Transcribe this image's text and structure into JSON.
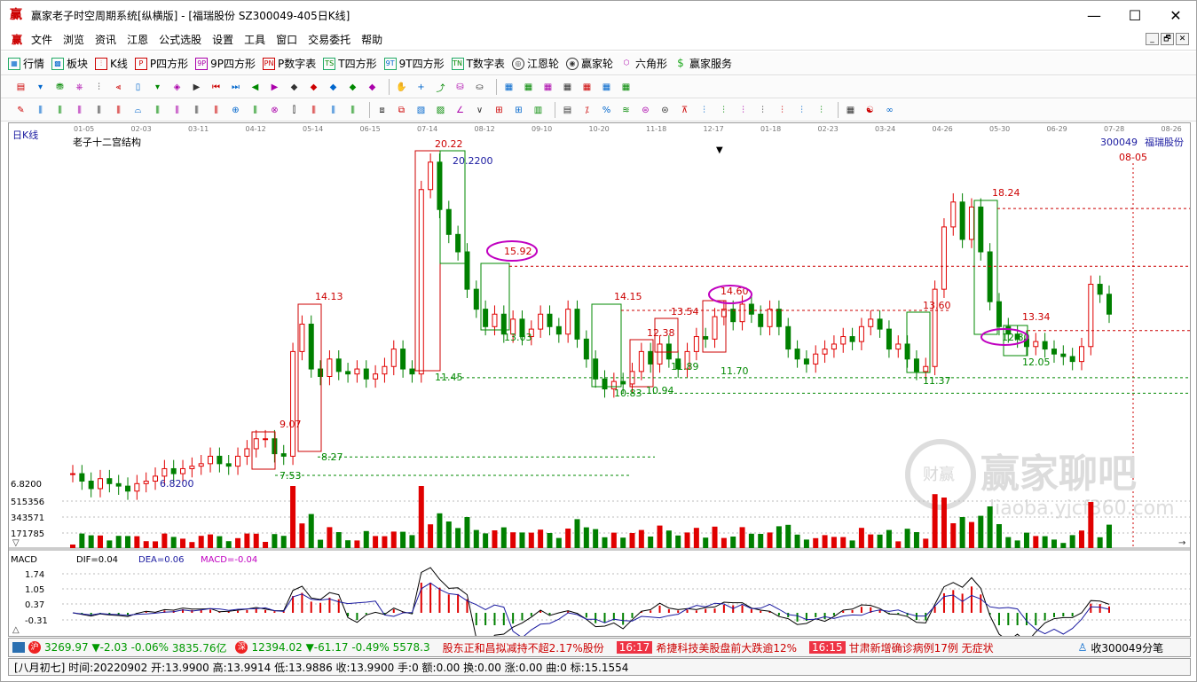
{
  "window": {
    "title": "赢家老子时空周期系统[纵横版] - [福瑞股份  SZ300049-405日K线]",
    "minimize": "—",
    "maximize": "☐",
    "close": "✕"
  },
  "menu": {
    "app_icon": "赢",
    "items": [
      "文件",
      "浏览",
      "资讯",
      "江恩",
      "公式选股",
      "设置",
      "工具",
      "窗口",
      "交易委托",
      "帮助"
    ]
  },
  "mdi": [
    "_",
    "🗗",
    "✕"
  ],
  "toolbar1": [
    {
      "label": "行情",
      "icon": "grid-icon"
    },
    {
      "label": "板块",
      "icon": "blocks-icon"
    },
    {
      "label": "K线",
      "icon": "candles-icon"
    },
    {
      "label": "P四方形",
      "icon": "P"
    },
    {
      "label": "9P四方形",
      "icon": "9P"
    },
    {
      "label": "P数字表",
      "icon": "PN"
    },
    {
      "label": "T四方形",
      "icon": "TS"
    },
    {
      "label": "9T四方形",
      "icon": "9T"
    },
    {
      "label": "T数字表",
      "icon": "TN"
    },
    {
      "label": "江恩轮",
      "icon": "wheel-icon"
    },
    {
      "label": "赢家轮",
      "icon": "wheel2-icon"
    },
    {
      "label": "六角形",
      "icon": "hexagon-icon"
    },
    {
      "label": "赢家服务",
      "icon": "dollar-icon"
    }
  ],
  "chart": {
    "period_label": "日K线",
    "indicator_name": "老子十二宫结构",
    "stock_code": "300049",
    "stock_name": "福瑞股份",
    "date_marker": "08-05",
    "x_dates": [
      "01-05",
      "02-03",
      "03-11",
      "04-12",
      "05-14",
      "06-15",
      "07-14",
      "08-12",
      "09-10",
      "10-20",
      "11-18",
      "12-17",
      "01-18",
      "02-23",
      "03-24",
      "04-26",
      "05-30",
      "06-29",
      "07-28",
      "08-26"
    ],
    "price_low_label": "6.8200",
    "price_labels": [
      {
        "t": "6.8200",
        "c": "#1a1aa0"
      },
      {
        "t": "9.07",
        "c": "#c00"
      },
      {
        "t": "8.27",
        "c": "#080"
      },
      {
        "t": "7.53",
        "c": "#080"
      },
      {
        "t": "14.13",
        "c": "#c00"
      },
      {
        "t": "20.22",
        "c": "#c00"
      },
      {
        "t": "20.2200",
        "c": "#1a1aa0"
      },
      {
        "t": "11.45",
        "c": "#080"
      },
      {
        "t": "15.92",
        "c": "#c00"
      },
      {
        "t": "13.03",
        "c": "#080"
      },
      {
        "t": "14.15",
        "c": "#c00"
      },
      {
        "t": "10.83",
        "c": "#080"
      },
      {
        "t": "12.38",
        "c": "#c00"
      },
      {
        "t": "10.94",
        "c": "#080"
      },
      {
        "t": "13.54",
        "c": "#c00"
      },
      {
        "t": "11.89",
        "c": "#080"
      },
      {
        "t": "14.60",
        "c": "#c00"
      },
      {
        "t": "11.70",
        "c": "#080"
      },
      {
        "t": "13.60",
        "c": "#c00"
      },
      {
        "t": "11.37",
        "c": "#080"
      },
      {
        "t": "18.24",
        "c": "#c00"
      },
      {
        "t": "13.34",
        "c": "#c00"
      },
      {
        "t": "12.80",
        "c": "#080"
      },
      {
        "t": "12.05",
        "c": "#080"
      }
    ],
    "volume_labels": [
      "515356",
      "343571",
      "171785"
    ],
    "macd": {
      "name": "MACD",
      "dif": "DIF=0.04",
      "dea": "DEA=0.06",
      "macd": "MACD=-0.04",
      "levels": [
        "1.74",
        "1.05",
        "0.37",
        "-0.31"
      ]
    },
    "watermark": {
      "brand": "赢家聊吧",
      "url": "liaoba.yjcf360.com",
      "badge": "财赢"
    }
  },
  "status1": {
    "sh": {
      "value": "3269.97",
      "change": "▼-2.03",
      "pct": "-0.06%",
      "amount": "3835.76亿"
    },
    "sz": {
      "value": "12394.02",
      "change": "▼-61.17",
      "pct": "-0.49%",
      "amount": "5578.3"
    },
    "news": [
      {
        "time": "",
        "text": "股东正和昌拟减持不超2.17%股份"
      },
      {
        "time": "16:17",
        "text": "希捷科技美股盘前大跌逾12%"
      },
      {
        "time": "16:15",
        "text": "甘肃新增确诊病例17例 无症状"
      }
    ],
    "right": "收300049分笔"
  },
  "status2": "[八月初七] 时间:20220902 开:13.9900 高:13.9914 低:13.9886 收:13.9900 手:0 额:0.00 换:0.00 涨:0.00 曲:0 标:15.1554",
  "colors": {
    "up": "#e00000",
    "down": "#008000",
    "accent": "#c000c0"
  }
}
